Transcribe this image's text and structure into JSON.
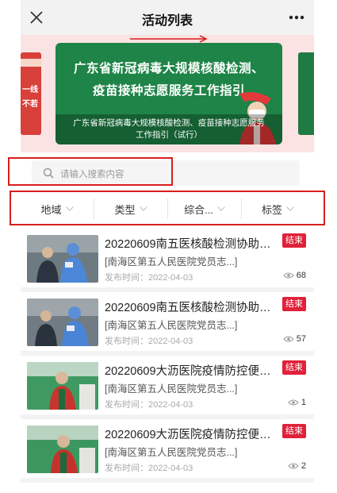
{
  "navbar": {
    "title": "活动列表"
  },
  "banner": {
    "headline_line1": "广东省新冠病毒大规模核酸检测、",
    "headline_line2": "疫苗接种志愿服务工作指引",
    "caption": "广东省新冠病毒大规模核酸检测、疫苗接种志愿服务工作指引（试行）",
    "side_left_text1": "一线",
    "side_left_text2": "不若"
  },
  "search": {
    "placeholder": "请输入搜索内容"
  },
  "filters": [
    {
      "label": "地域"
    },
    {
      "label": "类型"
    },
    {
      "label": "综合..."
    },
    {
      "label": "标签"
    }
  ],
  "activities": [
    {
      "title": "20220609南五医核酸检测协助…",
      "org": "[南海区第五人民医院党员志...]",
      "date": "发布时间：2022-04-03",
      "status": "结束",
      "views": "68"
    },
    {
      "title": "20220609南五医核酸检测协助…",
      "org": "[南海区第五人民医院党员志...]",
      "date": "发布时间：2022-04-03",
      "status": "结束",
      "views": "57"
    },
    {
      "title": "20220609大沥医院疫情防控便…",
      "org": "[南海区第五人民医院党员志...]",
      "date": "发布时间：2022-04-03",
      "status": "结束",
      "views": "1"
    },
    {
      "title": "20220609大沥医院疫情防控便…",
      "org": "[南海区第五人民医院党员志...]",
      "date": "发布时间：2022-04-03",
      "status": "结束",
      "views": "2"
    }
  ],
  "colors": {
    "badge": "#e0213a",
    "banner_green": "#1e8447",
    "annotation_red": "#d81e1e"
  }
}
